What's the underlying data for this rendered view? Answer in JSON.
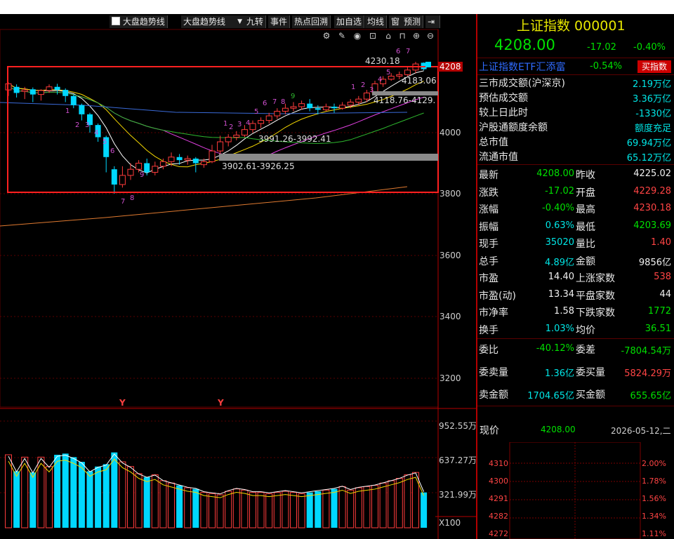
{
  "toolbar": {
    "checkbox_label": "大盘趋势线",
    "dropdown_value": "大盘趋势线",
    "buttons": [
      "九转",
      "事件",
      "热点回溯",
      "加自选",
      "均线",
      "窗",
      "预测"
    ],
    "icons": [
      "settings-icon",
      "pen-icon",
      "eye-icon",
      "lock-icon",
      "home-icon",
      "lock2-icon",
      "zoom-in-icon",
      "zoom-out-icon"
    ]
  },
  "header": {
    "title": "上证指数  000001",
    "price": "4208.00",
    "change": "-17.02",
    "change_pct": "-0.40%",
    "etf_name": "上证指数ETF汇添富",
    "etf_change": "-0.54%",
    "buy_button": "买指数"
  },
  "market_stats": [
    {
      "label": "三市成交额(沪深京)",
      "value": "2.19万亿"
    },
    {
      "label": "预估成交额",
      "value": "3.36万亿"
    },
    {
      "label": "较上日此时",
      "value": "-1330亿"
    },
    {
      "label": "沪股通额度余额",
      "value": "额度充足"
    },
    {
      "label": "总市值",
      "value": "69.94万亿"
    },
    {
      "label": "流通市值",
      "value": "65.12万亿"
    }
  ],
  "quote_grid": [
    {
      "l1": "最新",
      "v1": "4208.00",
      "l2": "昨收",
      "v2": "4225.02"
    },
    {
      "l1": "涨跌",
      "v1": "-17.02",
      "l2": "开盘",
      "v2": "4229.28"
    },
    {
      "l1": "涨幅",
      "v1": "-0.40%",
      "l2": "最高",
      "v2": "4230.18"
    },
    {
      "l1": "振幅",
      "v1": "0.63%",
      "l2": "最低",
      "v2": "4203.69"
    },
    {
      "l1": "现手",
      "v1": "35020",
      "l2": "量比",
      "v2": "1.40"
    },
    {
      "l1": "总手",
      "v1": "4.89亿",
      "l2": "金额",
      "v2": "9856亿"
    },
    {
      "l1": "市盈",
      "v1": "14.40",
      "l2": "上涨家数",
      "v2": "538"
    },
    {
      "l1": "市盈(动)",
      "v1": "13.34",
      "l2": "平盘家数",
      "v2": "44"
    },
    {
      "l1": "市净率",
      "v1": "1.58",
      "l2": "下跌家数",
      "v2": "1772"
    },
    {
      "l1": "换手",
      "v1": "1.03%",
      "l2": "均价",
      "v2": "36.51"
    }
  ],
  "order_stats": [
    {
      "l1": "委比",
      "v1": "-40.12%",
      "l2": "委差",
      "v2": "-7804.54万"
    },
    {
      "l1": "委卖量",
      "v1": "1.36亿",
      "l2": "委买量",
      "v2": "5824.29万"
    },
    {
      "l1": "卖金额",
      "v1": "1704.65亿",
      "l2": "买金额",
      "v2": "655.65亿"
    }
  ],
  "mini_chart": {
    "label": "现价",
    "price": "4208.00",
    "datetime": "2026-05-12,二",
    "y_ticks": [
      "4310",
      "4300",
      "4291",
      "4282",
      "4272"
    ],
    "pct_ticks": [
      "2.00%",
      "1.78%",
      "1.56%",
      "1.34%",
      "1.11%"
    ]
  },
  "main_chart": {
    "y_ticks": [
      "4208",
      "4000",
      "3800",
      "3600",
      "3400",
      "3200"
    ],
    "high_label": "4230.18",
    "annotations": [
      "4183.06",
      "4118.76-4129.",
      "3991.26-3992.41",
      "3902.61-3926.25"
    ],
    "bottom_markers": [
      "Y",
      "Y"
    ],
    "counts_top": [
      "1",
      "2",
      "3",
      "4",
      "5",
      "6",
      "7",
      "8",
      "9"
    ],
    "counts_low": [
      "1",
      "2",
      "3",
      "4",
      "5",
      "6",
      "7",
      "8",
      "9"
    ]
  },
  "volume_chart": {
    "y_ticks": [
      "952.55万",
      "637.27万",
      "321.99万"
    ],
    "unit": "X100"
  },
  "colors": {
    "up": "#ff3b3b",
    "down": "#00d8ff",
    "background": "#000000",
    "grid": "#5a0000",
    "title": "#e6e600"
  }
}
